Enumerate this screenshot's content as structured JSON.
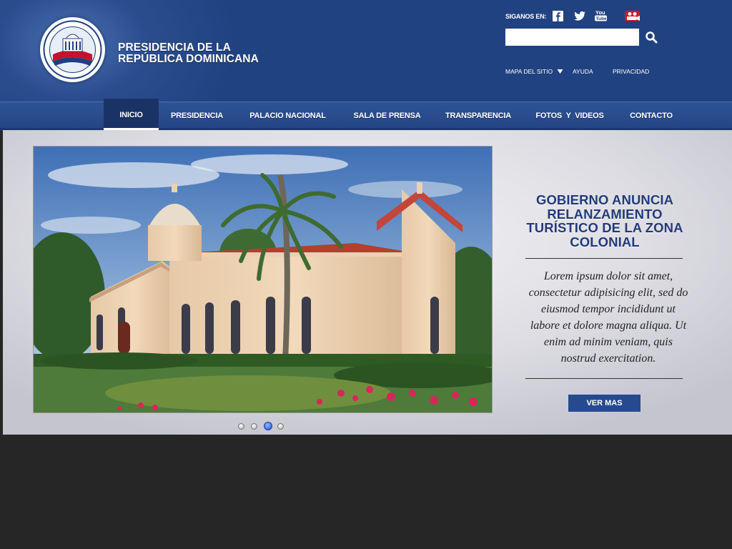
{
  "header": {
    "title_line1": "PRESIDENCIA DE LA",
    "title_line2": "REPÚBLICA DOMINICANA",
    "follow_label": "SIGANOS EN:",
    "social_icons": [
      "facebook-icon",
      "twitter-icon",
      "youtube-icon",
      "flickr-icon"
    ],
    "search": {
      "value": "",
      "placeholder": ""
    },
    "utility_links": [
      {
        "label": "MAPA DEL SITIO"
      },
      {
        "label": "AYUDA"
      },
      {
        "label": "PRIVACIDAD"
      }
    ]
  },
  "nav": {
    "items": [
      {
        "label": "INICIO",
        "active": true
      },
      {
        "label": "PRESIDENCIA"
      },
      {
        "label": "PALACIO NACIONAL"
      },
      {
        "label": "SALA DE PRENSA"
      },
      {
        "label": "TRANSPARENCIA"
      },
      {
        "label": "FOTOS  Y  VIDEOS"
      },
      {
        "label": "CONTACTO"
      }
    ]
  },
  "slider": {
    "headline": "GOBIERNO ANUNCIA RELANZAMIENTO TURÍSTICO DE LA ZONA COLONIAL",
    "body": "Lorem ipsum dolor sit amet, consectetur adipisicing elit, sed do eiusmod tempor incididunt ut labore et dolore magna aliqua. Ut enim ad minim veniam, quis nostrud exercitation.",
    "button_label": "VER MAS",
    "slide_count": 4,
    "active_slide": 3
  },
  "colors": {
    "header_blue": "#214281",
    "nav_blue": "#2e5395",
    "headline_blue": "#223a7a",
    "button_blue": "#254a8f",
    "footer_dark": "#262626"
  }
}
